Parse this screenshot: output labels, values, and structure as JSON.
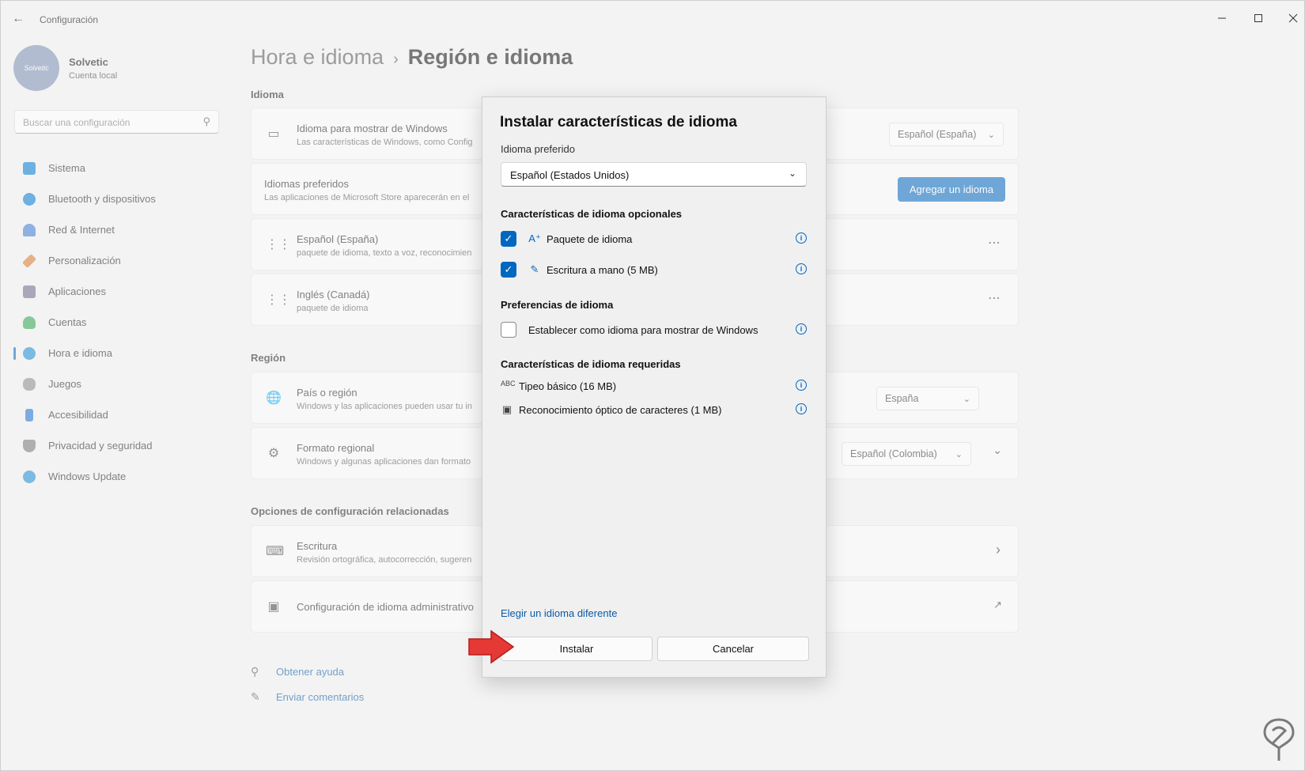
{
  "window": {
    "app_title": "Configuración"
  },
  "profile": {
    "name": "Solvetic",
    "subtitle": "Cuenta local",
    "avatar_text": "Solvetic"
  },
  "search": {
    "placeholder": "Buscar una configuración"
  },
  "sidebar": {
    "items": [
      {
        "label": "Sistema",
        "icon": "monitor-icon",
        "color": "#0078d4"
      },
      {
        "label": "Bluetooth y dispositivos",
        "icon": "bluetooth-icon",
        "color": "#0078d4"
      },
      {
        "label": "Red & Internet",
        "icon": "wifi-icon",
        "color": "#3a7bd5"
      },
      {
        "label": "Personalización",
        "icon": "brush-icon",
        "color": "#d97b2b"
      },
      {
        "label": "Aplicaciones",
        "icon": "apps-icon",
        "color": "#6b6b8a"
      },
      {
        "label": "Cuentas",
        "icon": "person-icon",
        "color": "#2ea44f"
      },
      {
        "label": "Hora e idioma",
        "icon": "globe-clock-icon",
        "color": "#1a8ad4"
      },
      {
        "label": "Juegos",
        "icon": "gamepad-icon",
        "color": "#8a8a8a"
      },
      {
        "label": "Accesibilidad",
        "icon": "accessibility-icon",
        "color": "#1a6fd4"
      },
      {
        "label": "Privacidad y seguridad",
        "icon": "shield-icon",
        "color": "#777777"
      },
      {
        "label": "Windows Update",
        "icon": "update-icon",
        "color": "#1a8ad4"
      }
    ],
    "active_index": 6
  },
  "breadcrumb": {
    "parent": "Hora e idioma",
    "current": "Región e idioma"
  },
  "main": {
    "section_language": "Idioma",
    "display_language": {
      "title": "Idioma para mostrar de Windows",
      "subtitle": "Las características de Windows, como Config",
      "value": "Español (España)"
    },
    "preferred_languages": {
      "title": "Idiomas preferidos",
      "subtitle": "Las aplicaciones de Microsoft Store aparecerán en el",
      "add_button": "Agregar un idioma"
    },
    "lang_spain": {
      "title": "Español (España)",
      "subtitle": "paquete de idioma, texto a voz, reconocimien"
    },
    "lang_canada": {
      "title": "Inglés (Canadá)",
      "subtitle": "paquete de idioma"
    },
    "section_region": "Región",
    "country": {
      "title": "País o región",
      "subtitle": "Windows y las aplicaciones pueden usar tu in",
      "value": "España"
    },
    "regional_format": {
      "title": "Formato regional",
      "subtitle": "Windows y algunas aplicaciones dan formato",
      "value": "Español (Colombia)"
    },
    "section_related": "Opciones de configuración relacionadas",
    "typing": {
      "title": "Escritura",
      "subtitle": "Revisión ortográfica, autocorrección, sugeren"
    },
    "admin_language": {
      "title": "Configuración de idioma administrativo"
    },
    "help_link": "Obtener ayuda",
    "feedback_link": "Enviar comentarios"
  },
  "dialog": {
    "title": "Instalar características de idioma",
    "preferred_label": "Idioma preferido",
    "preferred_value": "Español (Estados Unidos)",
    "optional_header": "Características de idioma opcionales",
    "optional_items": [
      {
        "label": "Paquete de idioma",
        "checked": true,
        "icon": "language-pack-icon"
      },
      {
        "label": "Escritura a mano (5 MB)",
        "checked": true,
        "icon": "handwriting-icon"
      }
    ],
    "preferences_header": "Preferencias de idioma",
    "preferences_items": [
      {
        "label": "Establecer como idioma para mostrar de Windows",
        "checked": false
      }
    ],
    "required_header": "Características de idioma requeridas",
    "required_items": [
      {
        "label": "Tipeo básico (16 MB)",
        "icon": "abc-icon"
      },
      {
        "label": "Reconocimiento óptico de caracteres (1 MB)",
        "icon": "ocr-camera-icon"
      }
    ],
    "choose_link": "Elegir un idioma diferente",
    "install_button": "Instalar",
    "cancel_button": "Cancelar"
  },
  "colors": {
    "accent": "#0067c0",
    "annotation_arrow": "#e53935"
  }
}
